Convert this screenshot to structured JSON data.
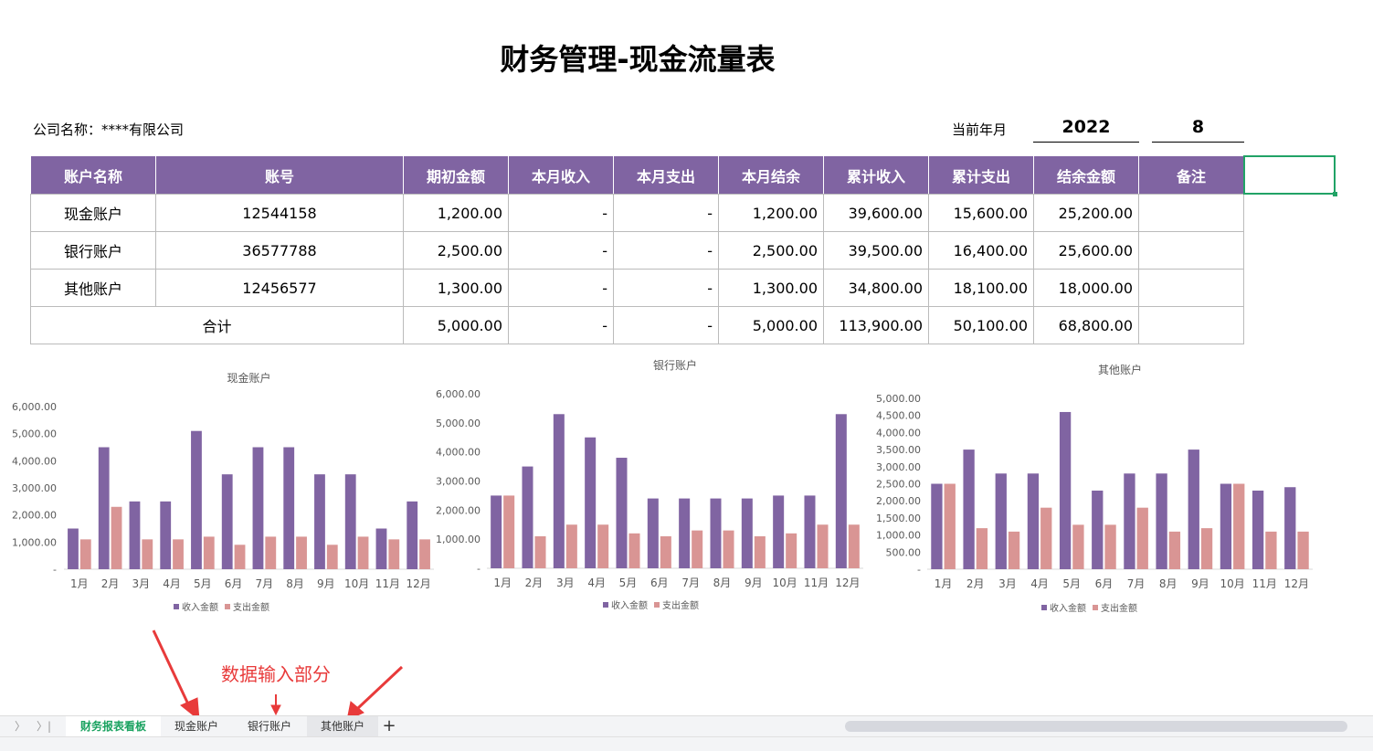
{
  "title": "财务管理-现金流量表",
  "company": "公司名称：****有限公司",
  "period": {
    "label": "当前年月",
    "year": "2022",
    "month": "8"
  },
  "table": {
    "headers": [
      "账户名称",
      "账号",
      "期初金额",
      "本月收入",
      "本月支出",
      "本月结余",
      "累计收入",
      "累计支出",
      "结余金额",
      "备注"
    ],
    "rows": [
      [
        "现金账户",
        "12544158",
        "1,200.00",
        "-",
        "-",
        "1,200.00",
        "39,600.00",
        "15,600.00",
        "25,200.00",
        ""
      ],
      [
        "银行账户",
        "36577788",
        "2,500.00",
        "-",
        "-",
        "2,500.00",
        "39,500.00",
        "16,400.00",
        "25,600.00",
        ""
      ],
      [
        "其他账户",
        "12456577",
        "1,300.00",
        "-",
        "-",
        "1,300.00",
        "34,800.00",
        "18,100.00",
        "18,000.00",
        ""
      ]
    ],
    "total": [
      "合计",
      "5,000.00",
      "-",
      "-",
      "5,000.00",
      "113,900.00",
      "50,100.00",
      "68,800.00",
      ""
    ]
  },
  "colors": {
    "income": "#8064a2",
    "expense": "#d99594",
    "header": "#8064a2",
    "annotation": "#e83a3a"
  },
  "chart_data": [
    {
      "type": "bar",
      "title": "现金账户",
      "categories": [
        "1月",
        "2月",
        "3月",
        "4月",
        "5月",
        "6月",
        "7月",
        "8月",
        "9月",
        "10月",
        "11月",
        "12月"
      ],
      "series": [
        {
          "name": "收入金额",
          "values": [
            1500,
            4500,
            2500,
            2500,
            5100,
            3500,
            4500,
            4500,
            3500,
            3500,
            1500,
            2500
          ]
        },
        {
          "name": "支出金额",
          "values": [
            1100,
            2300,
            1100,
            1100,
            1200,
            900,
            1200,
            1200,
            900,
            1200,
            1100,
            1100
          ]
        }
      ],
      "ylim": [
        0,
        6000
      ],
      "yticks": [
        "-",
        "1,000.00",
        "2,000.00",
        "3,000.00",
        "4,000.00",
        "5,000.00",
        "6,000.00"
      ],
      "legend": "bottom"
    },
    {
      "type": "bar",
      "title": "银行账户",
      "categories": [
        "1月",
        "2月",
        "3月",
        "4月",
        "5月",
        "6月",
        "7月",
        "8月",
        "9月",
        "10月",
        "11月",
        "12月"
      ],
      "series": [
        {
          "name": "收入金额",
          "values": [
            2500,
            3500,
            5300,
            4500,
            3800,
            2400,
            2400,
            2400,
            2400,
            2500,
            2500,
            5300
          ]
        },
        {
          "name": "支出金额",
          "values": [
            2500,
            1100,
            1500,
            1500,
            1200,
            1100,
            1300,
            1300,
            1100,
            1200,
            1500,
            1500
          ]
        }
      ],
      "ylim": [
        0,
        6000
      ],
      "yticks": [
        "-",
        "1,000.00",
        "2,000.00",
        "3,000.00",
        "4,000.00",
        "5,000.00",
        "6,000.00"
      ],
      "legend": "bottom"
    },
    {
      "type": "bar",
      "title": "其他账户",
      "categories": [
        "1月",
        "2月",
        "3月",
        "4月",
        "5月",
        "6月",
        "7月",
        "8月",
        "9月",
        "10月",
        "11月",
        "12月"
      ],
      "series": [
        {
          "name": "收入金额",
          "values": [
            2500,
            3500,
            2800,
            2800,
            4600,
            2300,
            2800,
            2800,
            3500,
            2500,
            2300,
            2400
          ]
        },
        {
          "name": "支出金额",
          "values": [
            2500,
            1200,
            1100,
            1800,
            1300,
            1300,
            1800,
            1100,
            1200,
            2500,
            1100,
            1100
          ]
        }
      ],
      "ylim": [
        0,
        5000
      ],
      "yticks": [
        "-",
        "500.00",
        "1,000.00",
        "1,500.00",
        "2,000.00",
        "2,500.00",
        "3,000.00",
        "3,500.00",
        "4,000.00",
        "4,500.00",
        "5,000.00"
      ],
      "legend": "bottom"
    }
  ],
  "annotation": "数据输入部分",
  "sheets": [
    "财务报表看板",
    "现金账户",
    "银行账户",
    "其他账户"
  ],
  "add_sheet": "+"
}
